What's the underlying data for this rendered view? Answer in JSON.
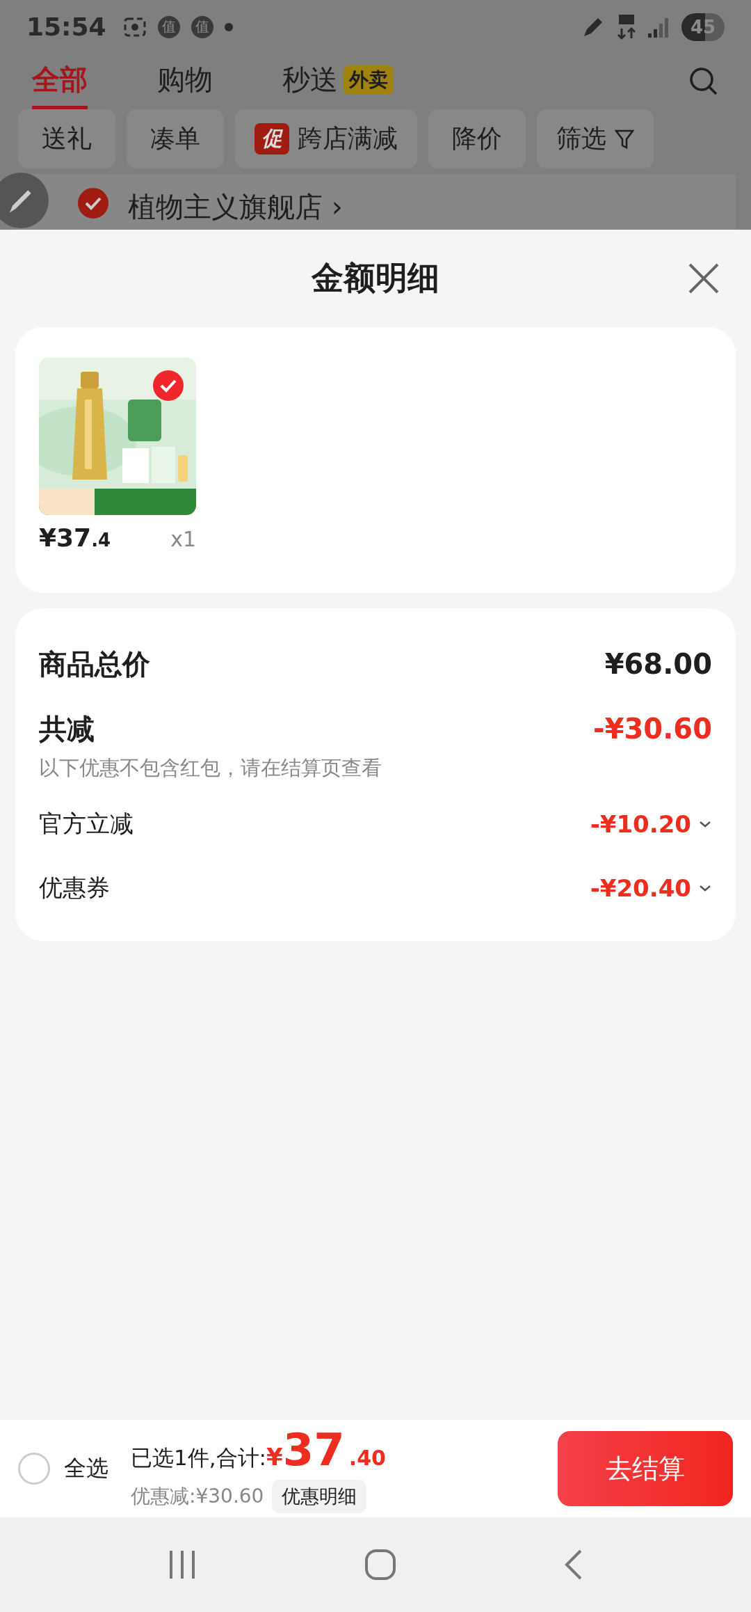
{
  "status_bar": {
    "time": "15:54",
    "notification_badges": [
      "值",
      "值"
    ],
    "battery": "45"
  },
  "tabs": [
    {
      "label": "全部",
      "selected": true
    },
    {
      "label": "购物",
      "selected": false
    },
    {
      "label": "秒送",
      "badge": "外卖",
      "selected": false
    }
  ],
  "filters": [
    {
      "label": "送礼"
    },
    {
      "label": "凑单"
    },
    {
      "label": "跨店满减",
      "tag": "促"
    },
    {
      "label": "降价"
    },
    {
      "label": "筛选",
      "kind": "filter"
    }
  ],
  "store": {
    "name": "植物主义旗舰店",
    "arrow": "›",
    "checked": true
  },
  "sheet": {
    "title": "金额明细",
    "item": {
      "selected": true,
      "kind": "picture",
      "price_integer": "¥37",
      "price_decimal": ".4",
      "quantity": "x1"
    },
    "total": {
      "label": "商品总价",
      "value": "¥68.00"
    },
    "discount": {
      "label": "共减",
      "value": "-¥30.60",
      "note": "以下优惠不包含红包，请在结算页查看"
    },
    "discount_items": [
      {
        "label": "官方立减",
        "value": "-¥10.20"
      },
      {
        "label": "优惠券",
        "value": "-¥20.40"
      }
    ]
  },
  "bottom_bar": {
    "select_all": {
      "label": "全选",
      "checked": false
    },
    "selected_text": "已选1件,合计:",
    "currency": "¥",
    "integer": "37",
    "decimal": ".40",
    "saving": "优惠减:¥30.60",
    "details_button": "优惠明细",
    "checkout": "去结算"
  }
}
